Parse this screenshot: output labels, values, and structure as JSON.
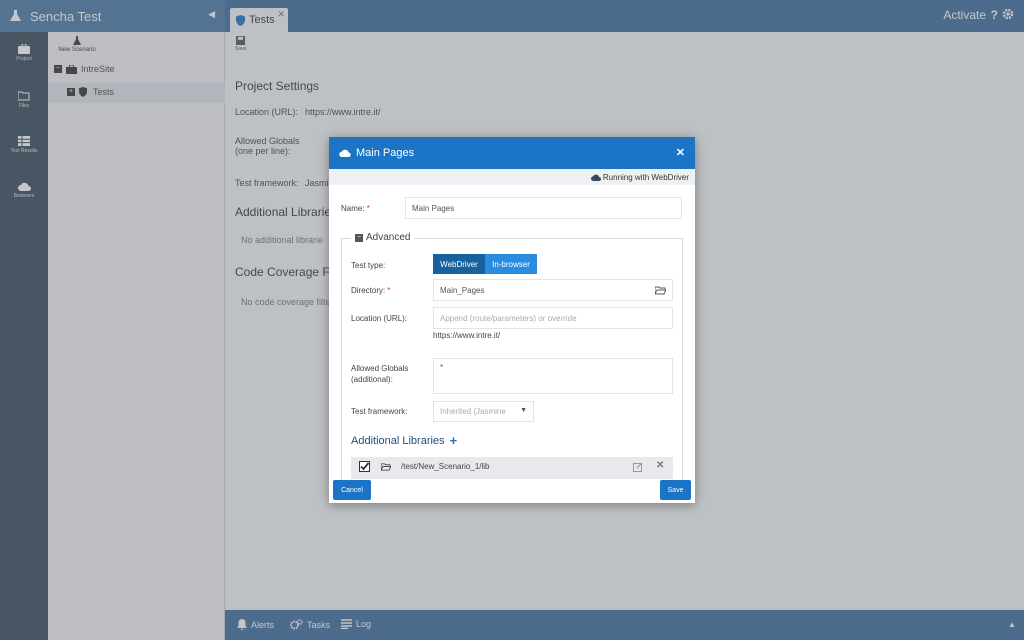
{
  "app": {
    "title": "Sencha Test"
  },
  "tabs": [
    {
      "label": "Tests"
    }
  ],
  "header": {
    "activate": "Activate",
    "help": "?"
  },
  "nav": [
    {
      "label": "Project",
      "icon": "briefcase-icon"
    },
    {
      "label": "Files",
      "icon": "folder-icon"
    },
    {
      "label": "Test Results",
      "icon": "table-icon"
    },
    {
      "label": "Browsers",
      "icon": "cloud-icon"
    }
  ],
  "tree": {
    "new_scenario": "New Scenario",
    "root": "IntreSite",
    "child": "Tests"
  },
  "toolbar": {
    "save": "Save"
  },
  "main": {
    "title": "Project Settings",
    "location_label": "Location (URL):",
    "location_value": "https://www.intre.it/",
    "globals_label_1": "Allowed Globals",
    "globals_label_2": "(one per line):",
    "framework_label": "Test framework:",
    "framework_value": "Jasmi",
    "libraries_heading": "Additional Librarie",
    "libraries_empty": "No additional librarie",
    "coverage_heading": "Code Coverage Filte",
    "coverage_empty": "No code coverage filters"
  },
  "bottom": {
    "alerts": "Alerts",
    "tasks": "Tasks",
    "log": "Log"
  },
  "modal": {
    "title": "Main Pages",
    "running": "Running with WebDriver",
    "name_label": "Name:",
    "name_value": "Main Pages",
    "advanced_label": "Advanced",
    "test_type_label": "Test type:",
    "test_type_options": [
      "WebDriver",
      "In-browser"
    ],
    "test_type_selected": "WebDriver",
    "directory_label": "Directory:",
    "directory_value": "Main_Pages",
    "location_label": "Location (URL):",
    "location_placeholder": "Append (route/parameters) or override",
    "location_hint": "https://www.intre.it/",
    "globals_label_1": "Allowed Globals",
    "globals_label_2": "(additional):",
    "globals_value": "*",
    "framework_label": "Test framework:",
    "framework_value": "Inherited (Jasmine",
    "libraries_heading": "Additional Libraries",
    "libraries": [
      {
        "path": "/test/New_Scenario_1/lib",
        "checked": true
      }
    ],
    "cancel": "Cancel",
    "save": "Save"
  },
  "colors": {
    "header": "#3f6e9f",
    "accent": "#1b74c6",
    "rail": "#37495a"
  }
}
